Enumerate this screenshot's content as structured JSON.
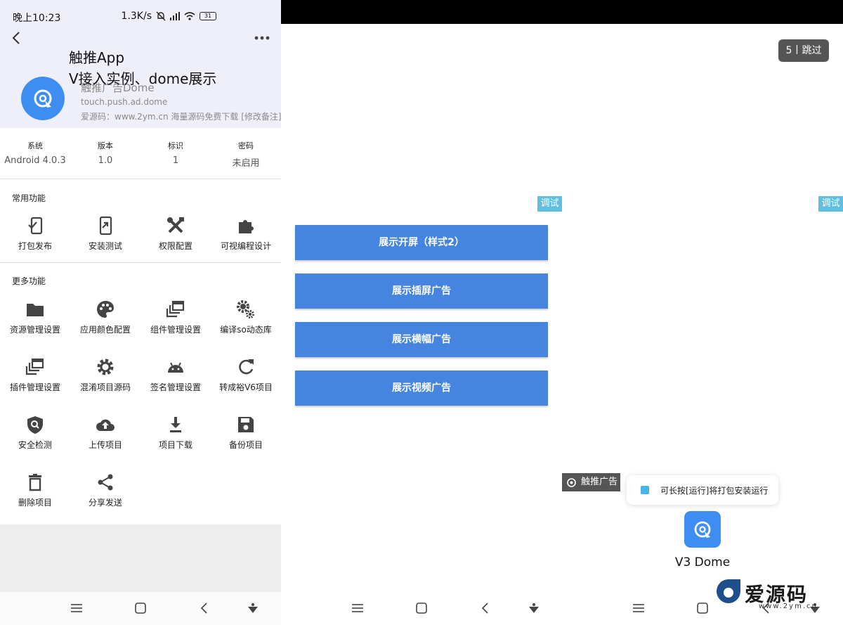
{
  "panel1": {
    "status": {
      "time": "晚上10:23",
      "speed": "1.3K/s",
      "battery": "31"
    },
    "overlay": {
      "title": "触推App",
      "subtitle": "V接入实例、dome展示"
    },
    "app": {
      "name": "触推广告Dome",
      "package": "touch.push.ad.dome",
      "note": "爱源码：www.2ym.cn 海量源码免费下载 [修改备注]"
    },
    "info": [
      {
        "label": "系统",
        "value": "Android 4.0.3"
      },
      {
        "label": "版本",
        "value": "1.0"
      },
      {
        "label": "标识",
        "value": "1"
      },
      {
        "label": "密码",
        "value": "未启用"
      }
    ],
    "common": {
      "title": "常用功能",
      "items": [
        {
          "label": "打包发布",
          "icon": "package-publish-icon"
        },
        {
          "label": "安装测试",
          "icon": "install-test-icon"
        },
        {
          "label": "权限配置",
          "icon": "tools-icon"
        },
        {
          "label": "可视编程设计",
          "icon": "puzzle-icon"
        }
      ]
    },
    "more": {
      "title": "更多功能",
      "items": [
        {
          "label": "资源管理设置",
          "icon": "folder-icon"
        },
        {
          "label": "应用颜色配置",
          "icon": "palette-icon"
        },
        {
          "label": "组件管理设置",
          "icon": "layers-icon"
        },
        {
          "label": "编译so动态库",
          "icon": "gears-icon"
        },
        {
          "label": "插件管理设置",
          "icon": "plugin-layers-icon"
        },
        {
          "label": "混淆项目源码",
          "icon": "gear-icon"
        },
        {
          "label": "签名管理设置",
          "icon": "android-icon"
        },
        {
          "label": "转成裕V6项目",
          "icon": "refresh-icon"
        },
        {
          "label": "安全检测",
          "icon": "shield-icon"
        },
        {
          "label": "上传项目",
          "icon": "cloud-upload-icon"
        },
        {
          "label": "项目下载",
          "icon": "download-icon"
        },
        {
          "label": "备份项目",
          "icon": "save-icon"
        },
        {
          "label": "删除项目",
          "icon": "trash-icon"
        },
        {
          "label": "分享发送",
          "icon": "share-icon"
        }
      ]
    }
  },
  "panel2": {
    "debug_label": "调试",
    "buttons": [
      "展示开屏（样式2）",
      "展示插屏广告",
      "展示横幅广告",
      "展示视频广告"
    ]
  },
  "panel3": {
    "debug_label": "调试",
    "skip_label": "5丨跳过",
    "ad_badge": "触推广告",
    "toast": "可长按[运行]将打包安装运行",
    "app_name": "V3 Dome",
    "watermark": {
      "brand": "爱源码",
      "url": "www.2ym.cn"
    }
  },
  "colors": {
    "primary_blue": "#4585e0",
    "app_icon_blue": "#3d8ef0",
    "debug_badge": "#5fc0e2",
    "header_bg": "#efeff9"
  }
}
